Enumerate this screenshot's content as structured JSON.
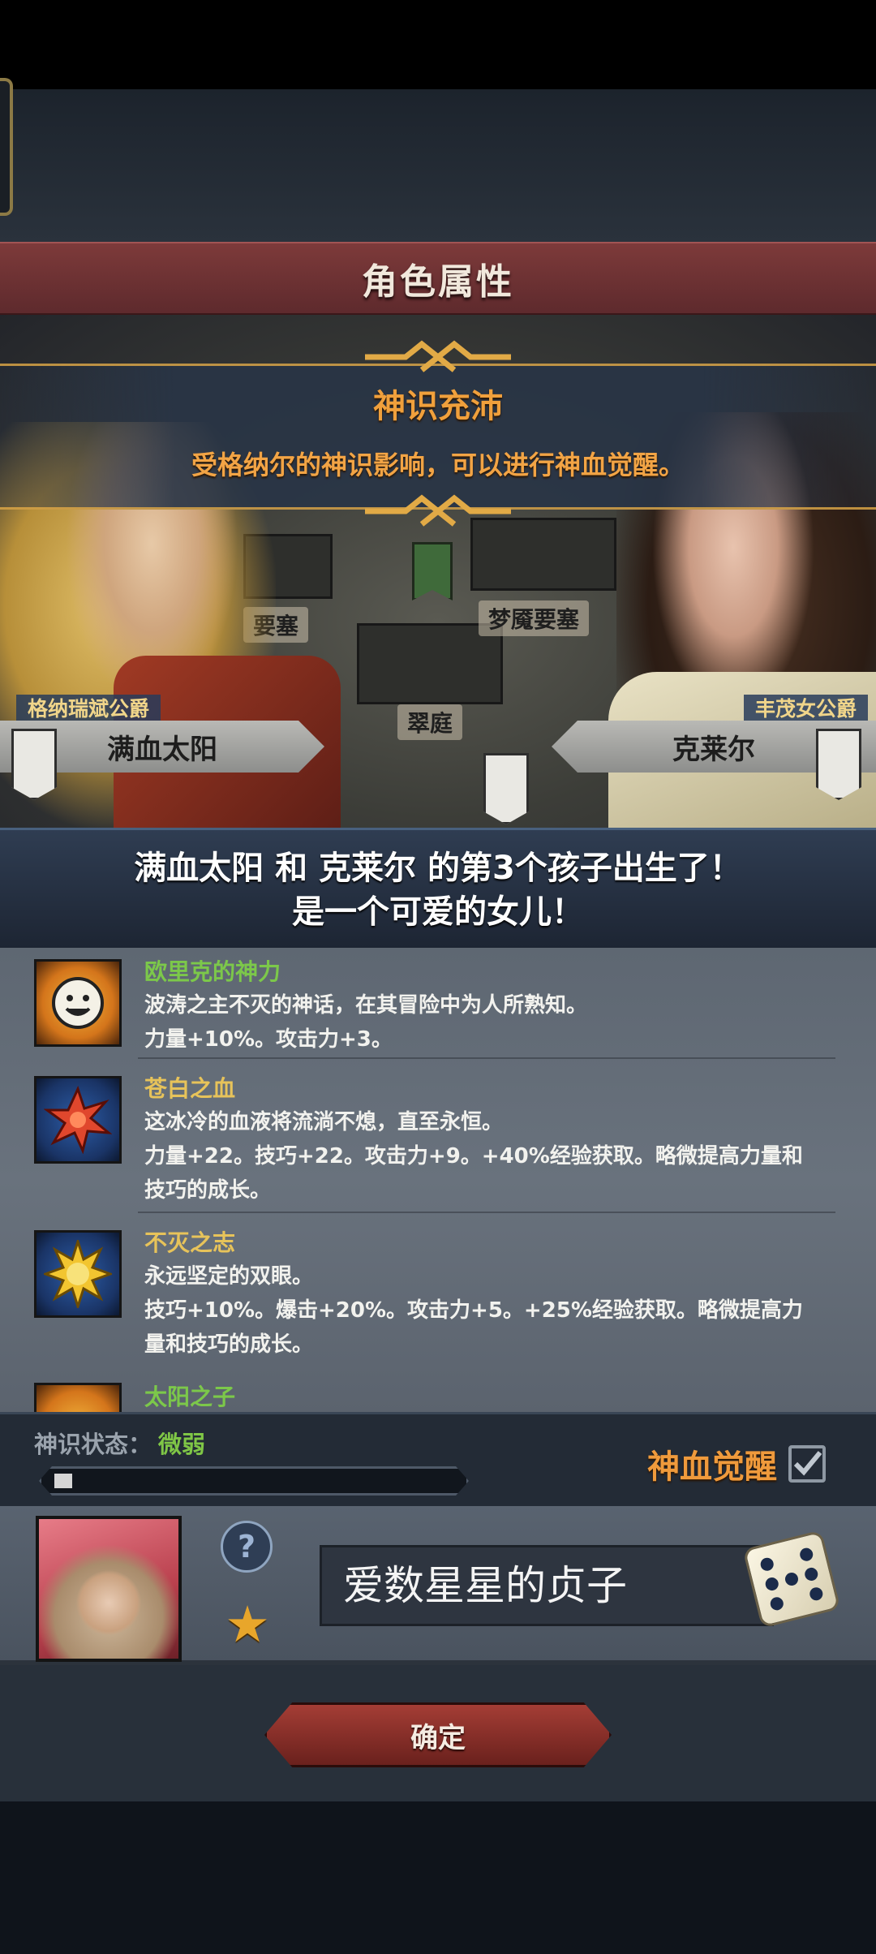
{
  "header": {
    "title": "角色属性"
  },
  "status_banner": {
    "title": "神识充沛",
    "description": "受格纳尔的神识影响，可以进行神血觉醒。"
  },
  "map": {
    "labels": [
      "要塞",
      "梦魇要塞",
      "翠庭"
    ]
  },
  "parents": {
    "father": {
      "title": "格纳瑞斌公爵",
      "name": "满血太阳"
    },
    "mother": {
      "title": "丰茂女公爵",
      "name": "克莱尔"
    }
  },
  "announcement": {
    "line1": "满血太阳 和 克莱尔 的第3个孩子出生了！",
    "line2": "是一个可爱的女儿！"
  },
  "traits": [
    {
      "name": "欧里克的神力",
      "name_color": "#7cc84a",
      "icon": "smiling-sun-icon",
      "description_lines": [
        "波涛之主不灭的神话，在其冒险中为人所熟知。",
        "力量+10%。攻击力+3。"
      ]
    },
    {
      "name": "苍白之血",
      "name_color": "#e7c35a",
      "icon": "blood-burst-icon",
      "description_lines": [
        "这冰冷的血液将流淌不熄，直至永恒。",
        "力量+22。技巧+22。攻击力+9。+40%经验获取。略微提高力量和",
        "技巧的成长。"
      ]
    },
    {
      "name": "不灭之志",
      "name_color": "#e7c35a",
      "icon": "golden-sun-icon",
      "description_lines": [
        "永远坚定的双眼。",
        "技巧+10%。爆击+20%。攻击力+5。+25%经验获取。略微提高力",
        "量和技巧的成长。"
      ]
    },
    {
      "name": "太阳之子",
      "name_color": "#7cc84a",
      "icon": "smiling-sun-icon",
      "description_lines": []
    }
  ],
  "divine_sense": {
    "label": "神识状态：",
    "value": "微弱",
    "progress": 0.03,
    "awaken_label": "神血觉醒",
    "awaken_checked": true
  },
  "child": {
    "name_value": "爱数星星的贞子",
    "help_glyph": "?",
    "star_glyph": "★"
  },
  "footer": {
    "confirm_label": "确定"
  }
}
